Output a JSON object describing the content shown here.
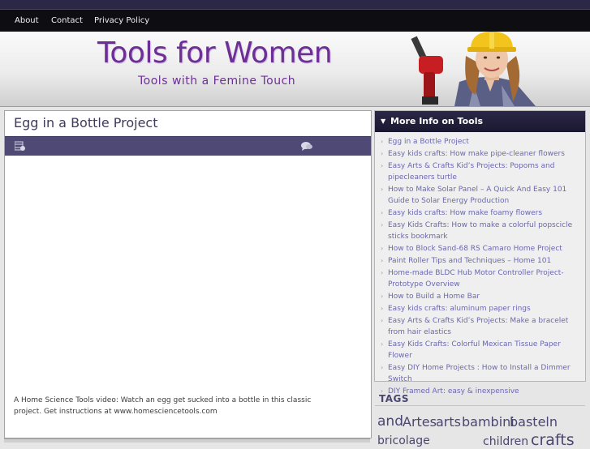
{
  "nav": {
    "items": [
      "About",
      "Contact",
      "Privacy Policy"
    ]
  },
  "header": {
    "title": "Tools for Women",
    "tagline": "Tools with a Femine Touch"
  },
  "post": {
    "title": "Egg in a Bottle Project",
    "icons": [
      "video-icon",
      "comment-bubble-icon"
    ],
    "text": "A Home Science Tools video: Watch an egg get sucked into a bottle in this classic project. Get instructions at www.homesciencetools.com"
  },
  "sidebar": {
    "heading": "More Info on Tools",
    "links": [
      "Egg in a Bottle Project",
      "Easy kids crafts: How make pipe-cleaner flowers",
      "Easy Arts & Crafts Kid’s Projects: Popoms and pipecleaners turtle",
      "How to Make Solar Panel – A Quick And Easy 101 Guide to Solar Energy Production",
      "Easy kids crafts: How make foamy flowers",
      "Easy Kids Crafts: How to make a colorful popscicle sticks bookmark",
      "How to Block Sand-68 RS Camaro Home Project",
      "Paint Roller Tips and Techniques – Home 101",
      "Home-made BLDC Hub Motor Controller Project- Prototype Overview",
      "How to Build a Home Bar",
      "Easy kids crafts: aluminum paper rings",
      "Easy Arts & Crafts Kid’s Projects: Make a bracelet from hair elastics",
      "Easy Kids Crafts: Colorful Mexican Tissue Paper Flower",
      "Easy DIY Home Projects : How to Install a Dimmer Switch",
      "DIY Framed Art: easy & inexpensive"
    ]
  },
  "tags": {
    "heading": "TAGS",
    "items": [
      "and",
      "Artes",
      "arts",
      "bambini",
      "basteln",
      "bricolage",
      "children",
      "crafts"
    ]
  },
  "colors": {
    "nav_bg": "#0e0e12",
    "title_purple": "#6d2f95",
    "link_color": "#6b67b0",
    "bar_color": "#4e4a75"
  }
}
